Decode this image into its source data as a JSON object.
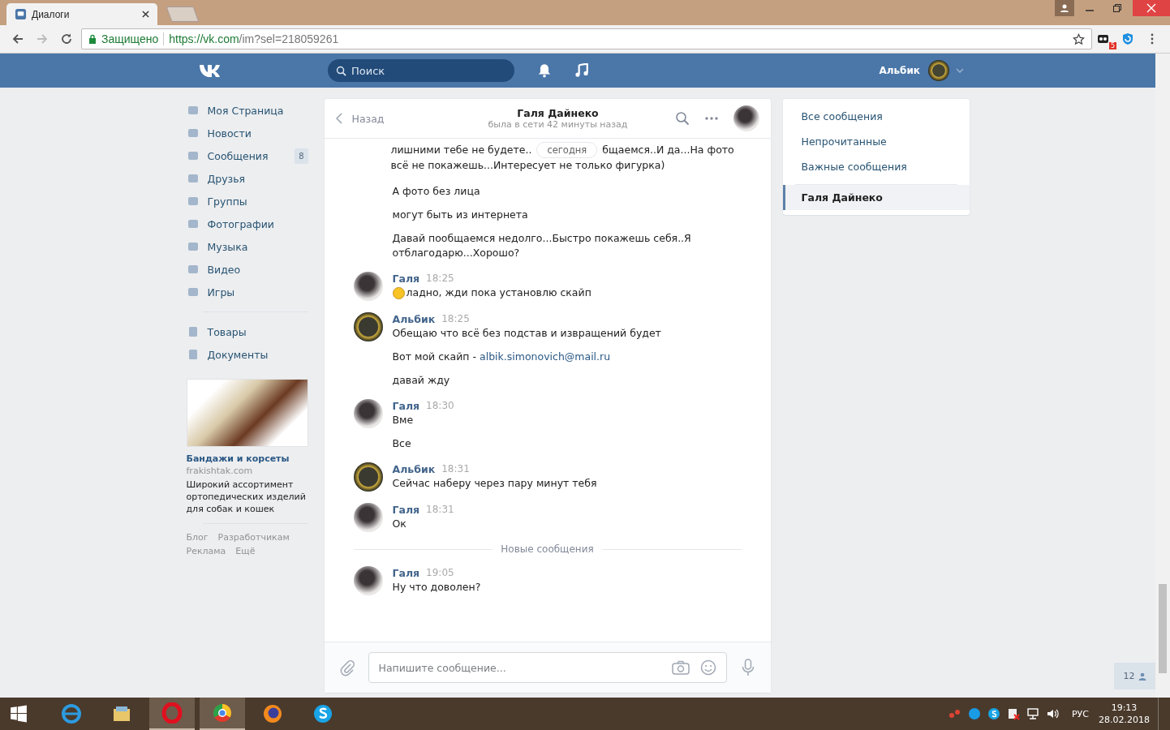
{
  "browser": {
    "tab": {
      "title": "Диалоги",
      "selected": true
    },
    "security": "Защищено",
    "url_host": "https://vk.com",
    "url_path": "/im?sel=218059261",
    "extension_badge": "5"
  },
  "header": {
    "search": {
      "placeholder": "Поиск"
    },
    "user_name": "Альбик"
  },
  "sidebar": {
    "items": [
      {
        "label": "Моя Страница"
      },
      {
        "label": "Новости"
      },
      {
        "label": "Сообщения",
        "count": "8"
      },
      {
        "label": "Друзья"
      },
      {
        "label": "Группы"
      },
      {
        "label": "Фотографии"
      },
      {
        "label": "Музыка"
      },
      {
        "label": "Видео"
      },
      {
        "label": "Игры"
      }
    ],
    "secondary_items": [
      {
        "label": "Товары"
      },
      {
        "label": "Документы"
      }
    ],
    "ad": {
      "title": "Бандажи и корсеты",
      "domain": "frakishtak.com",
      "text": "Широкий ассортимент ортопедических изделий для собак и кошек"
    },
    "footer_links": [
      "Блог",
      "Разработчикам",
      "Реклама",
      "Ещё"
    ]
  },
  "chat": {
    "back": "Назад",
    "title": "Галя Дайнеко",
    "status": "была в сети 42 минуты назад",
    "date_pill": "сегодня",
    "first_message_before": "лишними тебе не будете..",
    "first_message_after": "бщаемся..И да...На фото",
    "first_message_rest": "всё не покажешь...Интересует не только фигурка)",
    "groups": [
      {
        "kind": "continued",
        "messages": [
          {
            "text": "А фото без лица"
          },
          {
            "text": "могут быть из интернета"
          },
          {
            "text": "Давай пообщаемся недолго...Быстро покажешь себя..Я отблагодарю...Хорошо?"
          }
        ]
      },
      {
        "kind": "contact",
        "author": "Галя",
        "time": "18:25",
        "messages": [
          {
            "text": "ладно, жди пока установлю скайп",
            "emoji": true
          }
        ]
      },
      {
        "kind": "self",
        "author": "Альбик",
        "time": "18:25",
        "messages": [
          {
            "text": "Обещаю что всё без подстав и извращений будет"
          },
          {
            "text": "Вот мой скайп - ",
            "link": "albik.simonovich@mail.ru"
          },
          {
            "text": "давай жду"
          }
        ]
      },
      {
        "kind": "contact",
        "author": "Галя",
        "time": "18:30",
        "messages": [
          {
            "text": "Вме"
          },
          {
            "text": "Все"
          }
        ]
      },
      {
        "kind": "self",
        "author": "Альбик",
        "time": "18:31",
        "messages": [
          {
            "text": "Сейчас наберу через пару минут тебя"
          }
        ]
      },
      {
        "kind": "contact",
        "author": "Галя",
        "time": "18:31",
        "messages": [
          {
            "text": "Ок"
          }
        ]
      },
      {
        "kind": "divider",
        "label": "Новые сообщения"
      },
      {
        "kind": "contact",
        "author": "Галя",
        "time": "19:05",
        "messages": [
          {
            "text": "Ну что доволен?"
          }
        ]
      }
    ],
    "composer": {
      "placeholder": "Напишите сообщение..."
    }
  },
  "right_menu": [
    {
      "label": "Все сообщения",
      "selected": false
    },
    {
      "label": "Непрочитанные",
      "selected": false
    },
    {
      "label": "Важные сообщения",
      "selected": false
    },
    {
      "label": "Галя Дайнеко",
      "selected": true
    }
  ],
  "online_counter": "12",
  "taskbar": {
    "language": "РУС",
    "time": "19:13",
    "date": "28.02.2018"
  }
}
